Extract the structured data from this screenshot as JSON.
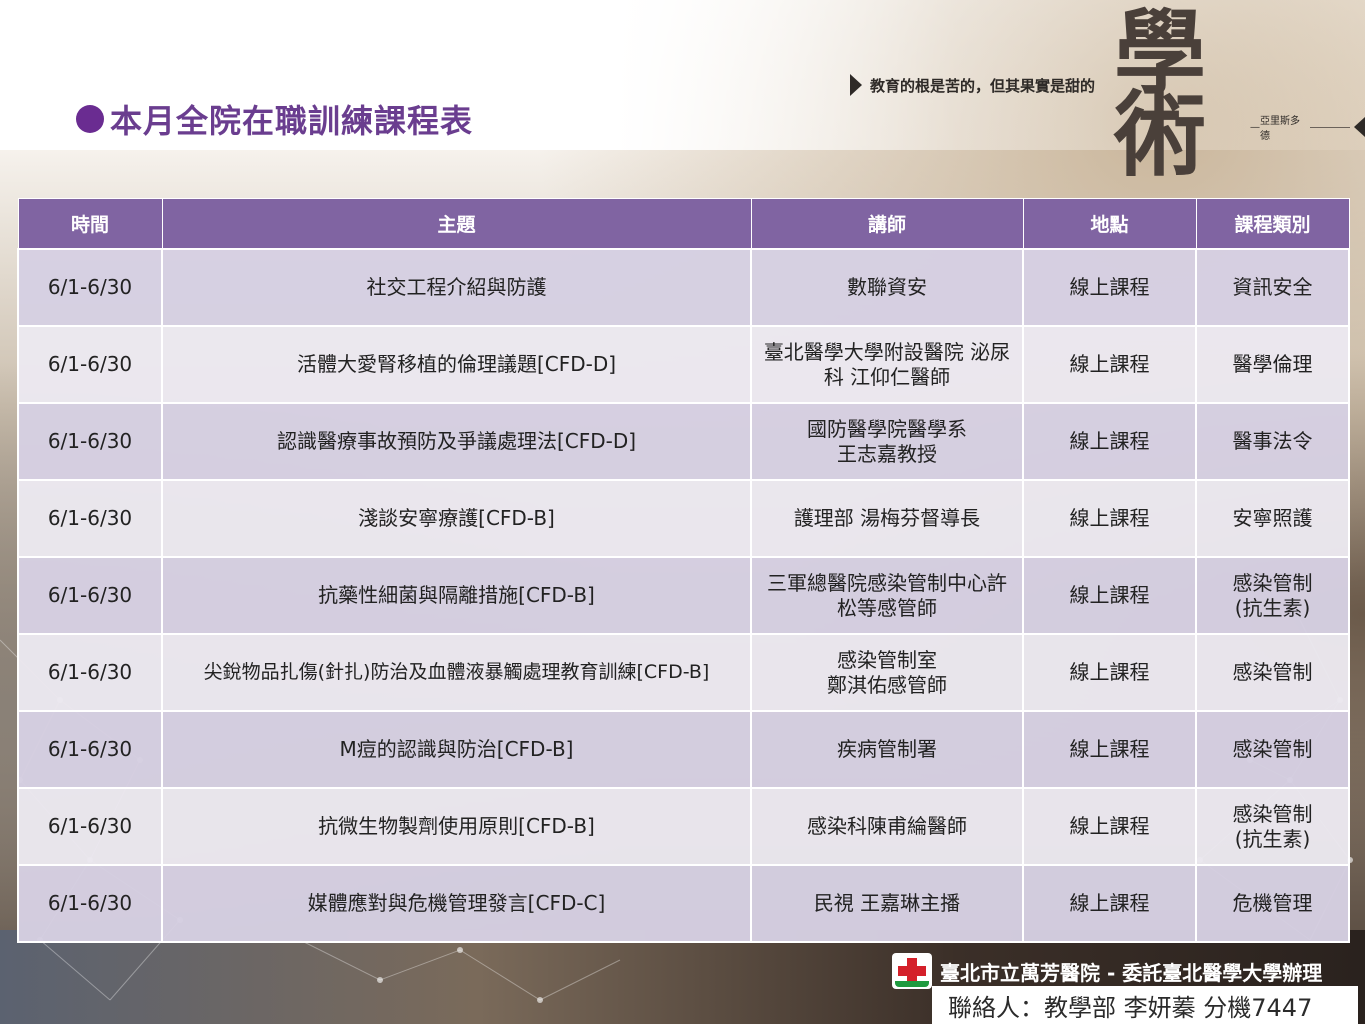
{
  "page_title": "本月全院在職訓練課程表",
  "header_decor": {
    "quote": "教育的根是苦的，但其果實是甜的",
    "attribution": "亞里斯多德",
    "big_mark_1": "學",
    "big_mark_2": "術"
  },
  "table": {
    "headers": [
      "時間",
      "主題",
      "講師",
      "地點",
      "課程類別"
    ],
    "rows": [
      {
        "time": "6/1-6/30",
        "topic": "社交工程介紹與防護",
        "lecturer": "數聯資安",
        "lecturer_2": "",
        "location": "線上課程",
        "category": "資訊安全",
        "category_2": ""
      },
      {
        "time": "6/1-6/30",
        "topic": "活體大愛腎移植的倫理議題[CFD-D]",
        "lecturer": "臺北醫學大學附設醫院 泌尿",
        "lecturer_2": "科 江仰仁醫師",
        "location": "線上課程",
        "category": "醫學倫理",
        "category_2": ""
      },
      {
        "time": "6/1-6/30",
        "topic": "認識醫療事故預防及爭議處理法[CFD-D]",
        "lecturer": "國防醫學院醫學系",
        "lecturer_2": "王志嘉教授",
        "location": "線上課程",
        "category": "醫事法令",
        "category_2": ""
      },
      {
        "time": "6/1-6/30",
        "topic": "淺談安寧療護[CFD-B]",
        "lecturer": "護理部 湯梅芬督導長",
        "lecturer_2": "",
        "location": "線上課程",
        "category": "安寧照護",
        "category_2": ""
      },
      {
        "time": "6/1-6/30",
        "topic": "抗藥性細菌與隔離措施[CFD-B]",
        "lecturer": "三軍總醫院感染管制中心許",
        "lecturer_2": "松等感管師",
        "location": "線上課程",
        "category": "感染管制",
        "category_2": "(抗生素)"
      },
      {
        "time": "6/1-6/30",
        "topic": "尖銳物品扎傷(針扎)防治及血體液暴觸處理教育訓練[CFD-B]",
        "lecturer": "感染管制室",
        "lecturer_2": "鄭淇佑感管師",
        "location": "線上課程",
        "category": "感染管制",
        "category_2": ""
      },
      {
        "time": "6/1-6/30",
        "topic": "M痘的認識與防治[CFD-B]",
        "lecturer": "疾病管制署",
        "lecturer_2": "",
        "location": "線上課程",
        "category": "感染管制",
        "category_2": ""
      },
      {
        "time": "6/1-6/30",
        "topic": "抗微生物製劑使用原則[CFD-B]",
        "lecturer": "感染科陳甫綸醫師",
        "lecturer_2": "",
        "location": "線上課程",
        "category": "感染管制",
        "category_2": "(抗生素)"
      },
      {
        "time": "6/1-6/30",
        "topic": "媒體應對與危機管理發言[CFD-C]",
        "lecturer": "民視 王嘉琳主播",
        "lecturer_2": "",
        "location": "線上課程",
        "category": "危機管理",
        "category_2": ""
      }
    ]
  },
  "footer": {
    "hospital": "臺北市立萬芳醫院 - 委託臺北醫學大學辦理",
    "contact": "聯絡人：教學部 李妍蓁 分機7447",
    "logo_icon": "hospital-cross-icon"
  }
}
